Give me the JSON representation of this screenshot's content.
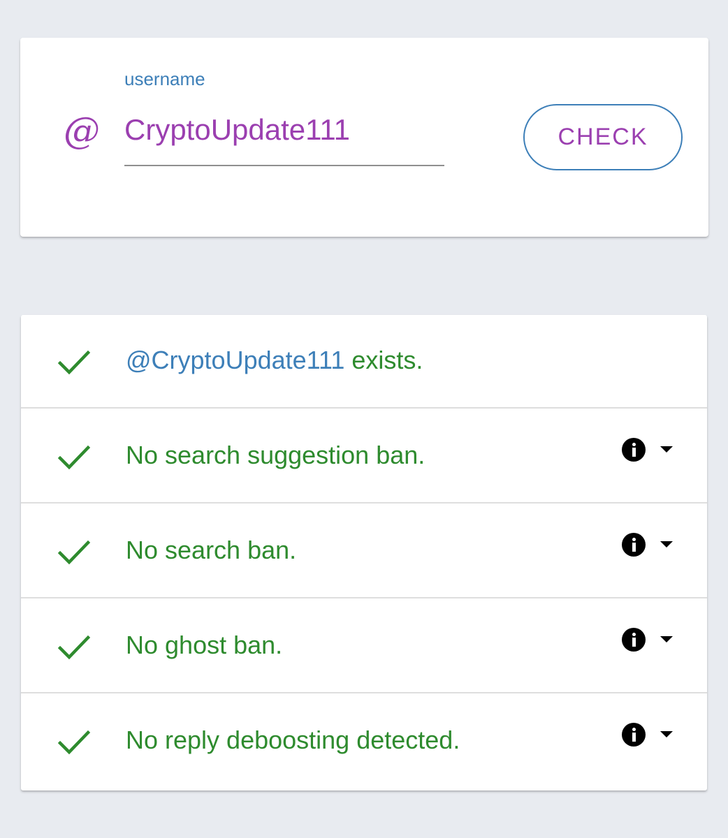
{
  "input_card": {
    "field_label": "username",
    "at_symbol": "@",
    "username_value": "CryptoUpdate111",
    "check_button_label": "CHECK"
  },
  "results": [
    {
      "handle": "@CryptoUpdate111",
      "text": " exists.",
      "status_icon": "check-icon",
      "has_info": false
    },
    {
      "text": "No search suggestion ban.",
      "status_icon": "check-icon",
      "has_info": true
    },
    {
      "text": "No search ban.",
      "status_icon": "check-icon",
      "has_info": true
    },
    {
      "text": "No ghost ban.",
      "status_icon": "check-icon",
      "has_info": true
    },
    {
      "text": "No reply deboosting detected.",
      "status_icon": "check-icon",
      "has_info": true
    }
  ],
  "colors": {
    "background": "#e8ebf0",
    "accent_purple": "#9b3fb0",
    "accent_blue": "#3d7fb8",
    "success_green": "#2e8b2e"
  }
}
